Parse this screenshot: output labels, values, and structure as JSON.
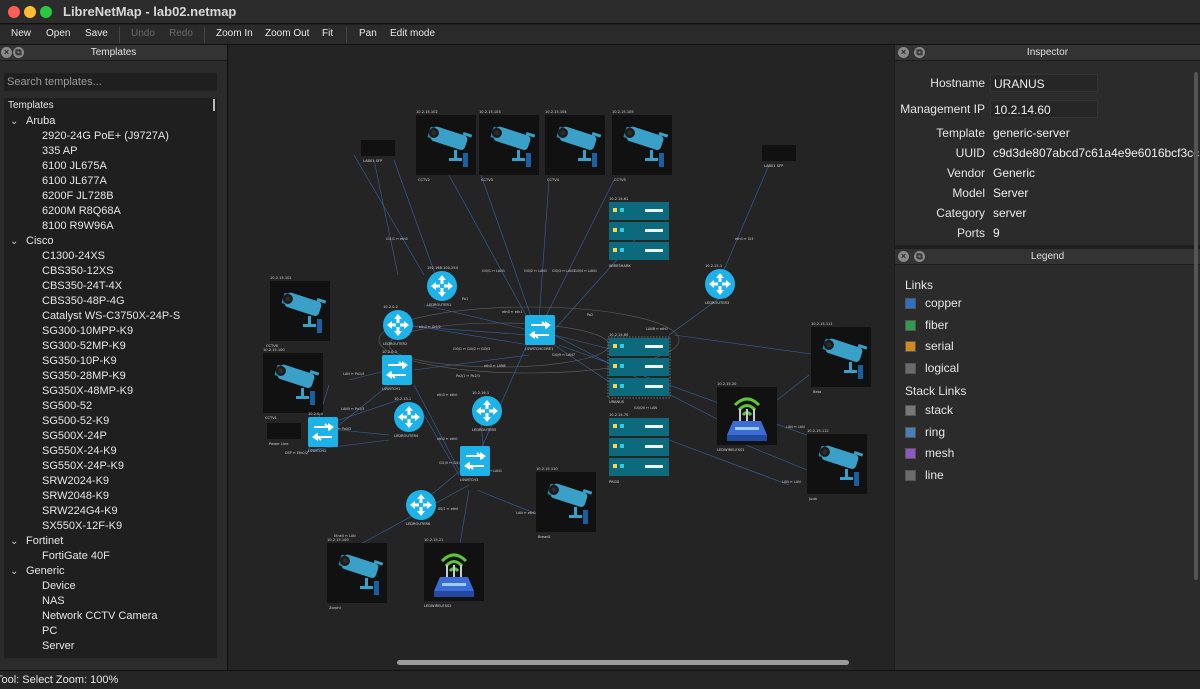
{
  "window": {
    "title": "LibreNetMap - lab02.netmap"
  },
  "toolbar": {
    "new": "New",
    "open": "Open",
    "save": "Save",
    "undo": "Undo",
    "redo": "Redo",
    "zoom_in": "Zoom In",
    "zoom_out": "Zoom Out",
    "fit": "Fit",
    "pan": "Pan",
    "edit_mode": "Edit mode"
  },
  "templates": {
    "title": "Templates",
    "search_placeholder": "Search templates...",
    "root_label": "Templates",
    "groups": [
      {
        "name": "Aruba",
        "items": [
          "2920-24G PoE+ (J9727A)",
          "335 AP",
          "6100 JL675A",
          "6100 JL677A",
          "6200F JL728B",
          "6200M R8Q68A",
          "8100 R9W96A"
        ]
      },
      {
        "name": "Cisco",
        "items": [
          "C1300-24XS",
          "CBS350-12XS",
          "CBS350-24T-4X",
          "CBS350-48P-4G",
          "Catalyst WS-C3750X-24P-S",
          "SG300-10MPP-K9",
          "SG300-52MP-K9",
          "SG350-10P-K9",
          "SG350-28MP-K9",
          "SG350X-48MP-K9",
          "SG500-52",
          "SG500-52-K9",
          "SG500X-24P",
          "SG550X-24-K9",
          "SG550X-24P-K9",
          "SRW2024-K9",
          "SRW2048-K9",
          "SRW224G4-K9",
          "SX550X-12F-K9"
        ]
      },
      {
        "name": "Fortinet",
        "items": [
          "FortiGate 40F"
        ]
      },
      {
        "name": "Generic",
        "items": [
          "Device",
          "NAS",
          "Network CCTV Camera",
          "PC",
          "Server"
        ]
      }
    ]
  },
  "inspector": {
    "title": "Inspector",
    "fields": [
      {
        "label": "Hostname",
        "value": "URANUS",
        "editable": true
      },
      {
        "label": "Management IP",
        "value": "10.2.14.60",
        "editable": true
      },
      {
        "label": "Template",
        "value": "generic-server",
        "editable": false
      },
      {
        "label": "UUID",
        "value": "c9d3de807abcd7c61a4e9e6016bcf3cc",
        "editable": false
      },
      {
        "label": "Vendor",
        "value": "Generic",
        "editable": false
      },
      {
        "label": "Model",
        "value": "Server",
        "editable": false
      },
      {
        "label": "Category",
        "value": "server",
        "editable": false
      },
      {
        "label": "Ports",
        "value": "9",
        "editable": false
      }
    ]
  },
  "legend": {
    "title": "Legend",
    "links_heading": "Links",
    "links": [
      {
        "label": "copper",
        "color": "#2f6fc4"
      },
      {
        "label": "fiber",
        "color": "#2e9b4f"
      },
      {
        "label": "serial",
        "color": "#d4891f"
      },
      {
        "label": "logical",
        "color": "#6b6b6b"
      }
    ],
    "stack_heading": "Stack Links",
    "stack_links": [
      {
        "label": "stack",
        "color": "#777777"
      },
      {
        "label": "ring",
        "color": "#4a7ebb"
      },
      {
        "label": "mesh",
        "color": "#8e57c2"
      },
      {
        "label": "line",
        "color": "#6b6b6b"
      }
    ]
  },
  "status": {
    "text": "Tool: Select  Zoom: 100%"
  },
  "map": {
    "devices": [
      {
        "type": "camera",
        "label": "CCTV2"
      },
      {
        "type": "camera",
        "label": "CCTV3"
      },
      {
        "type": "camera",
        "label": "CCTV4"
      },
      {
        "type": "camera",
        "label": "CCTV5"
      },
      {
        "type": "camera",
        "label": "CCTV1"
      },
      {
        "type": "camera",
        "label": "CCTV6"
      },
      {
        "type": "camera",
        "label": "Beta"
      },
      {
        "type": "camera",
        "label": "Juda"
      },
      {
        "type": "camera",
        "label": "Bread1"
      },
      {
        "type": "camera",
        "label": "Zorphi"
      },
      {
        "type": "server",
        "label": "WIRESHARK"
      },
      {
        "type": "server",
        "label": "URANUS"
      },
      {
        "type": "server",
        "label": "PROD"
      },
      {
        "type": "switch",
        "label": "LSWITCHCORE1"
      },
      {
        "type": "switch",
        "label": "LSWITCH1"
      },
      {
        "type": "switch",
        "label": "LSWITCH2"
      },
      {
        "type": "switch",
        "label": "LSWITCH3"
      },
      {
        "type": "router",
        "label": "LEDROUTER1"
      },
      {
        "type": "router",
        "label": "LEDROUTER2"
      },
      {
        "type": "router",
        "label": "LEDROUTER3"
      },
      {
        "type": "router",
        "label": "LEDROUTER4"
      },
      {
        "type": "router",
        "label": "LEDROUTER5"
      },
      {
        "type": "router",
        "label": "LEDROUTER6"
      },
      {
        "type": "ap",
        "label": "LEDWIRELESS1"
      },
      {
        "type": "ap",
        "label": "LEDWIRELESS2"
      },
      {
        "type": "box",
        "label": "LAB01 SFP"
      },
      {
        "type": "box",
        "label": "LAB01 SFP"
      },
      {
        "type": "box",
        "label": "Power Line"
      }
    ]
  }
}
